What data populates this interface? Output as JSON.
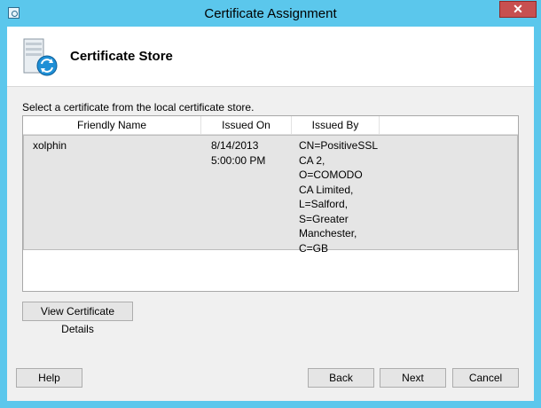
{
  "window": {
    "title": "Certificate Assignment",
    "close_glyph": "✕",
    "icon": "certificate-app-icon"
  },
  "header": {
    "title": "Certificate Store",
    "icon": "server-sync-icon"
  },
  "instruction": "Select a certificate from the local certificate store.",
  "table": {
    "columns": [
      "Friendly Name",
      "Issued On",
      "Issued By"
    ],
    "rows": [
      {
        "friendly_name": "xolphin",
        "issued_on": "8/14/2013\n5:00:00 PM",
        "issued_by": "CN=PositiveSSL\nCA 2,\nO=COMODO\nCA Limited,\nL=Salford,\nS=Greater\nManchester,\nC=GB"
      }
    ]
  },
  "buttons": {
    "view_details": "View Certificate Details",
    "help": "Help",
    "back": "Back",
    "next": "Next",
    "cancel": "Cancel"
  },
  "colors": {
    "titlebar": "#5bc7ec",
    "close": "#c75050",
    "dialog_bg": "#f0f0f0",
    "selected_row": "#e5e5e5"
  }
}
